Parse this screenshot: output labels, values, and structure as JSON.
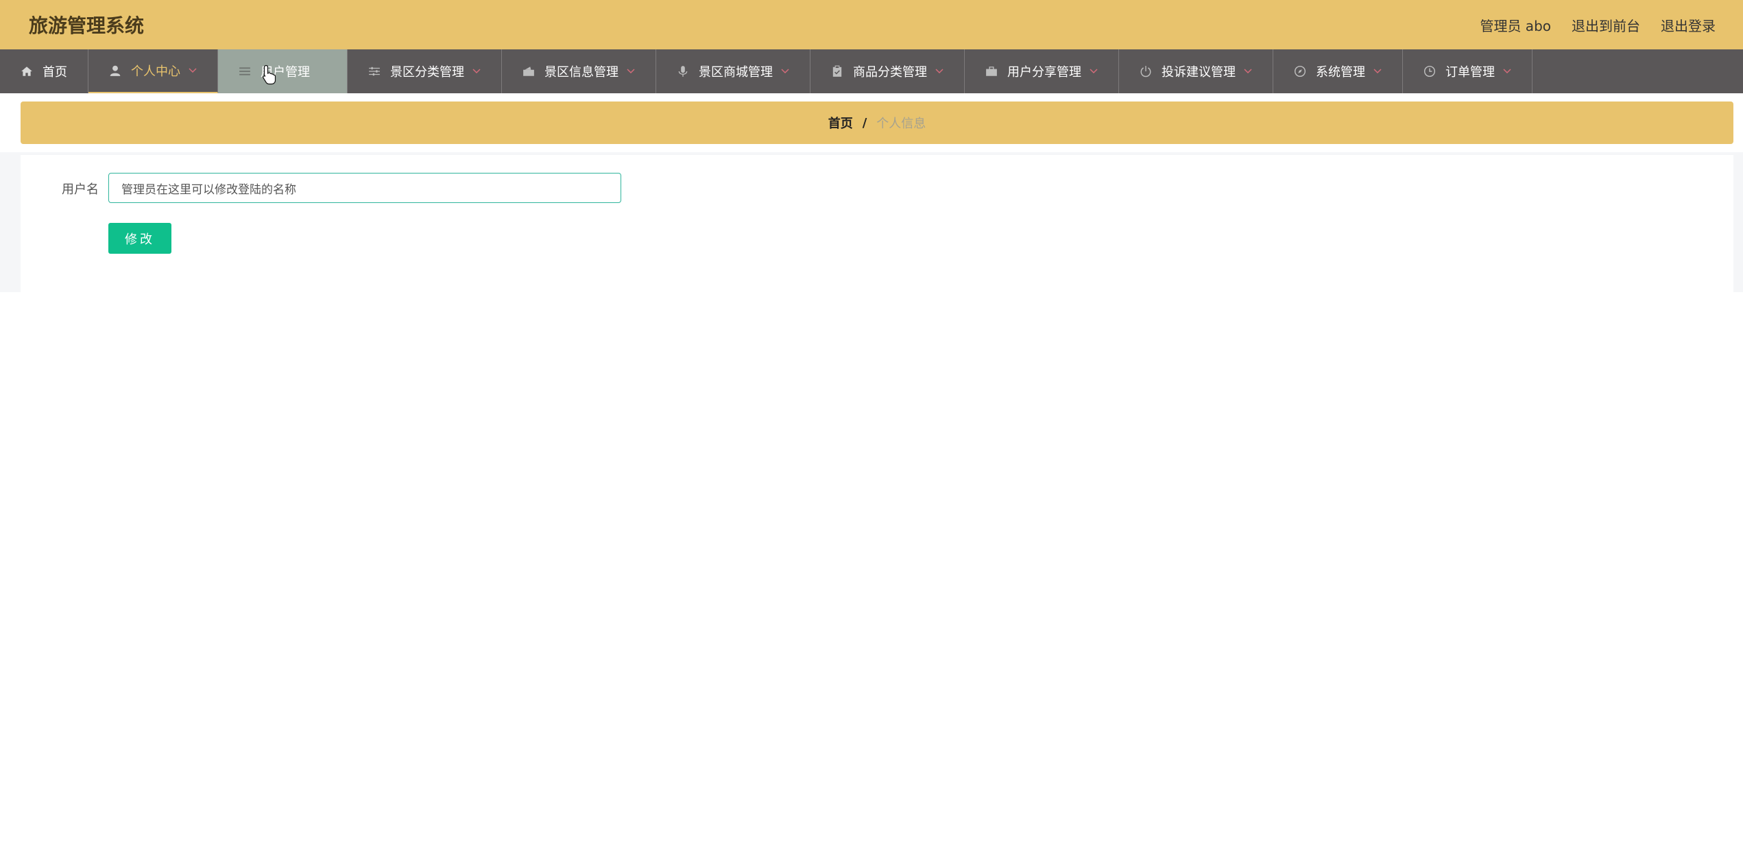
{
  "header": {
    "title": "旅游管理系统",
    "links": [
      "管理员 abo",
      "退出到前台",
      "退出登录"
    ]
  },
  "nav": {
    "items": [
      {
        "label": "首页",
        "icon": "home-icon"
      },
      {
        "label": "个人中心",
        "icon": "user-icon"
      },
      {
        "label": "用户管理",
        "icon": "list-icon"
      },
      {
        "label": "景区分类管理",
        "icon": "sliders-icon"
      },
      {
        "label": "景区信息管理",
        "icon": "wallet-icon"
      },
      {
        "label": "景区商城管理",
        "icon": "microphone-icon"
      },
      {
        "label": "商品分类管理",
        "icon": "clipboard-icon"
      },
      {
        "label": "用户分享管理",
        "icon": "briefcase-icon"
      },
      {
        "label": "投诉建议管理",
        "icon": "power-icon"
      },
      {
        "label": "系统管理",
        "icon": "compass-icon"
      },
      {
        "label": "订单管理",
        "icon": "clock-icon"
      }
    ],
    "active_index": 1,
    "hover_index": 2
  },
  "breadcrumb": {
    "home": "首页",
    "separator": "/",
    "current": "个人信息"
  },
  "form": {
    "username_label": "用户名",
    "username_value": "管理员在这里可以修改登陆的名称",
    "submit_label": "修改"
  },
  "colors": {
    "header_bg": "#e8c36d",
    "nav_bg": "#5a5758",
    "accent": "#0fbf8c",
    "input_border": "#2fb59c"
  }
}
